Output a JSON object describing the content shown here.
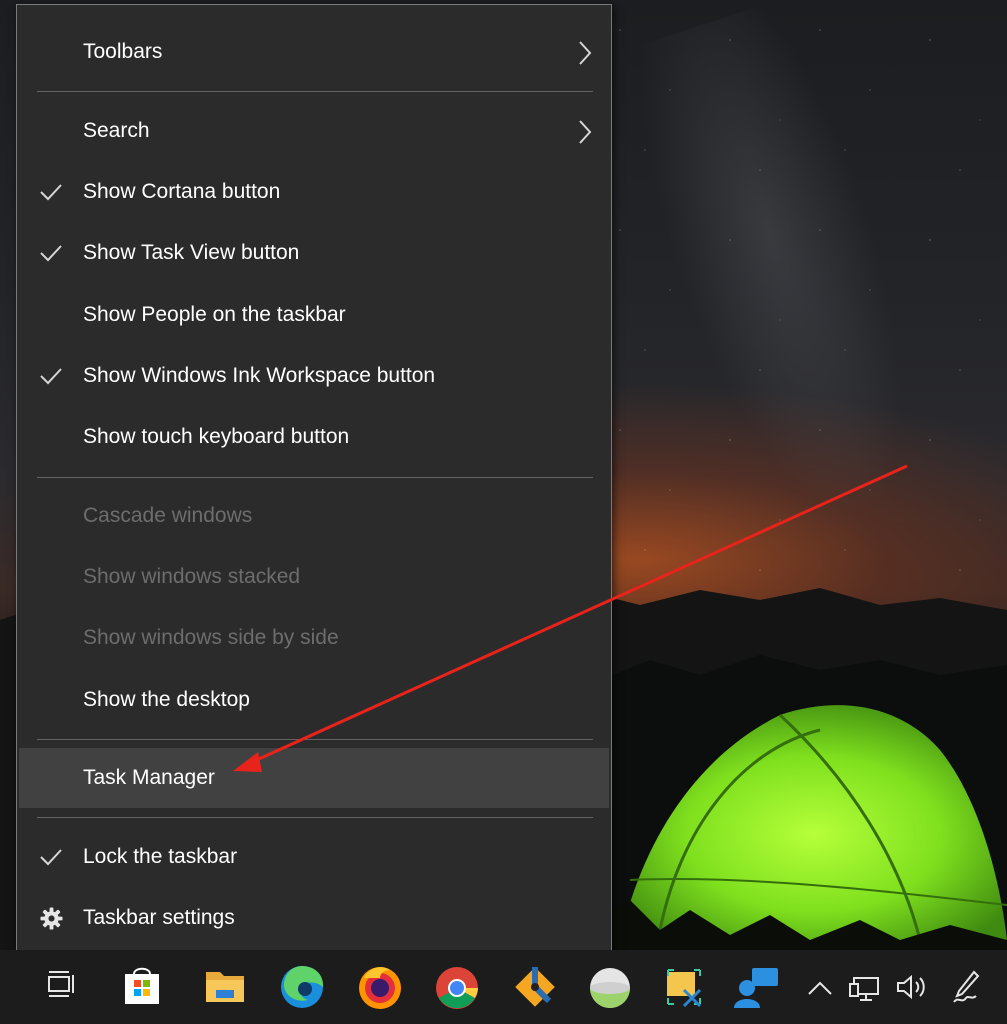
{
  "context_menu": {
    "items": [
      {
        "label": "Toolbars",
        "checked": false,
        "submenu": true,
        "disabled": false
      },
      {
        "label": "Search",
        "checked": false,
        "submenu": true,
        "disabled": false
      },
      {
        "label": "Show Cortana button",
        "checked": true,
        "submenu": false,
        "disabled": false
      },
      {
        "label": "Show Task View button",
        "checked": true,
        "submenu": false,
        "disabled": false
      },
      {
        "label": "Show People on the taskbar",
        "checked": false,
        "submenu": false,
        "disabled": false
      },
      {
        "label": "Show Windows Ink Workspace button",
        "checked": true,
        "submenu": false,
        "disabled": false
      },
      {
        "label": "Show touch keyboard button",
        "checked": false,
        "submenu": false,
        "disabled": false
      },
      {
        "label": "Cascade windows",
        "checked": false,
        "submenu": false,
        "disabled": true
      },
      {
        "label": "Show windows stacked",
        "checked": false,
        "submenu": false,
        "disabled": true
      },
      {
        "label": "Show windows side by side",
        "checked": false,
        "submenu": false,
        "disabled": true
      },
      {
        "label": "Show the desktop",
        "checked": false,
        "submenu": false,
        "disabled": false
      },
      {
        "label": "Task Manager",
        "checked": false,
        "submenu": false,
        "disabled": false,
        "highlighted": true
      },
      {
        "label": "Lock the taskbar",
        "checked": true,
        "submenu": false,
        "disabled": false
      },
      {
        "label": "Taskbar settings",
        "checked": false,
        "submenu": false,
        "disabled": false,
        "icon": "gear-icon"
      }
    ]
  },
  "taskbar": {
    "icons": [
      "task-view-icon",
      "microsoft-store-icon",
      "file-explorer-icon",
      "edge-icon",
      "firefox-icon",
      "chrome-icon",
      "git-icon",
      "disk-icon",
      "snipping-tool-icon",
      "feedback-hub-icon",
      "show-hidden-icons-chevron",
      "network-icon",
      "volume-icon",
      "windows-ink-icon"
    ]
  },
  "colors": {
    "menu_bg": "#2b2b2b",
    "menu_hover": "#414141",
    "menu_text": "#ffffff",
    "menu_disabled_text": "#6d6d6d",
    "annotation_arrow": "#e8231b",
    "taskbar_bg": "#1c1c1c"
  }
}
